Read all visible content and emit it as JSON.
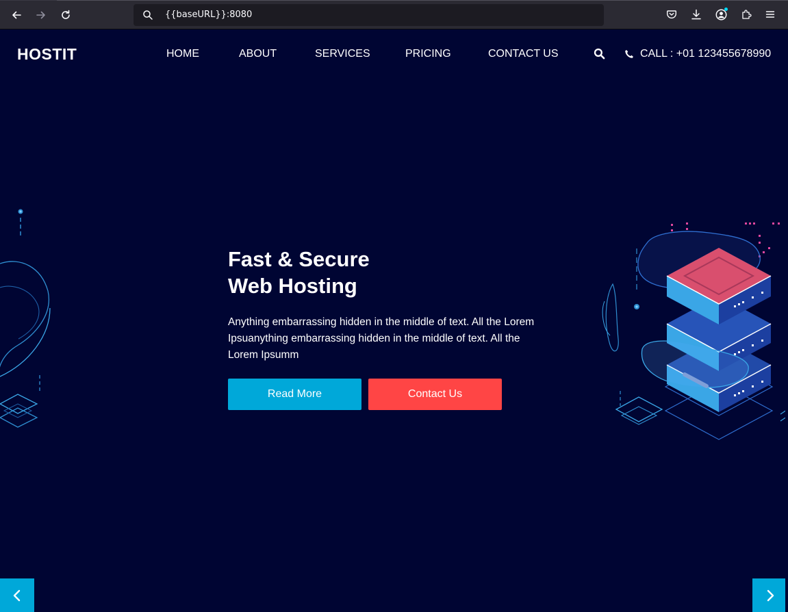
{
  "browser": {
    "url": "{{baseURL}}:8080",
    "icons": [
      "back-icon",
      "forward-icon",
      "reload-icon",
      "search-icon",
      "pocket-icon",
      "download-icon",
      "account-icon",
      "extensions-icon",
      "menu-icon"
    ]
  },
  "header": {
    "brand": "HOSTIT",
    "nav": [
      "HOME",
      "ABOUT",
      "SERVICES",
      "PRICING",
      "CONTACT US"
    ],
    "call": "CALL : +01 123455678990",
    "icons": [
      "search-icon",
      "phone-icon"
    ]
  },
  "hero": {
    "title_line1": "Fast & Secure",
    "title_line2": "Web Hosting",
    "description": "Anything embarrassing hidden in the middle of text. All the Lorem Ipsuanything embarrassing hidden in the middle of text. All the Lorem Ipsumm",
    "read_more": "Read More",
    "contact_us": "Contact Us"
  },
  "slider": {
    "icons": [
      "chevron-left-icon",
      "chevron-right-icon"
    ]
  },
  "colors": {
    "background": "#000533",
    "accent": "#00a8d9",
    "contact": "#ff4545",
    "server_top": "#d94f6e",
    "server_side": "#2a66c9"
  }
}
